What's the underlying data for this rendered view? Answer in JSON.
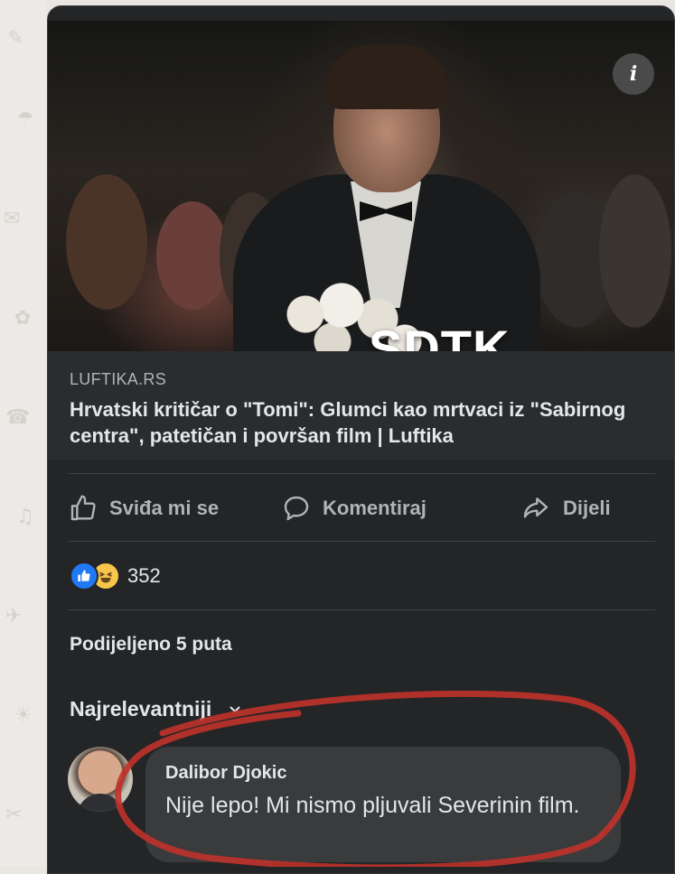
{
  "link_preview": {
    "overlay_text": "SDTK",
    "domain": "LUFTIKA.RS",
    "headline": "Hrvatski kritičar o \"Tomi\": Glumci kao mrtvaci iz \"Sabirnog centra\", patetičan i površan film | Luftika",
    "info_icon": "info-icon"
  },
  "actions": {
    "like_label": "Sviđa mi se",
    "comment_label": "Komentiraj",
    "share_label": "Dijeli"
  },
  "reactions": {
    "count": "352",
    "types": [
      "like",
      "haha"
    ]
  },
  "shares": {
    "label": "Podijeljeno 5 puta"
  },
  "comments": {
    "sort_label": "Najrelevantniji",
    "items": [
      {
        "author": "Dalibor Djokic",
        "text": "Nije lepo! Mi nismo pljuvali Severinin film."
      }
    ]
  },
  "colors": {
    "card_bg": "#242526",
    "link_bg": "#2b2c2f",
    "comment_bubble": "#3a3b3c",
    "annotation_red": "#c0322b"
  }
}
